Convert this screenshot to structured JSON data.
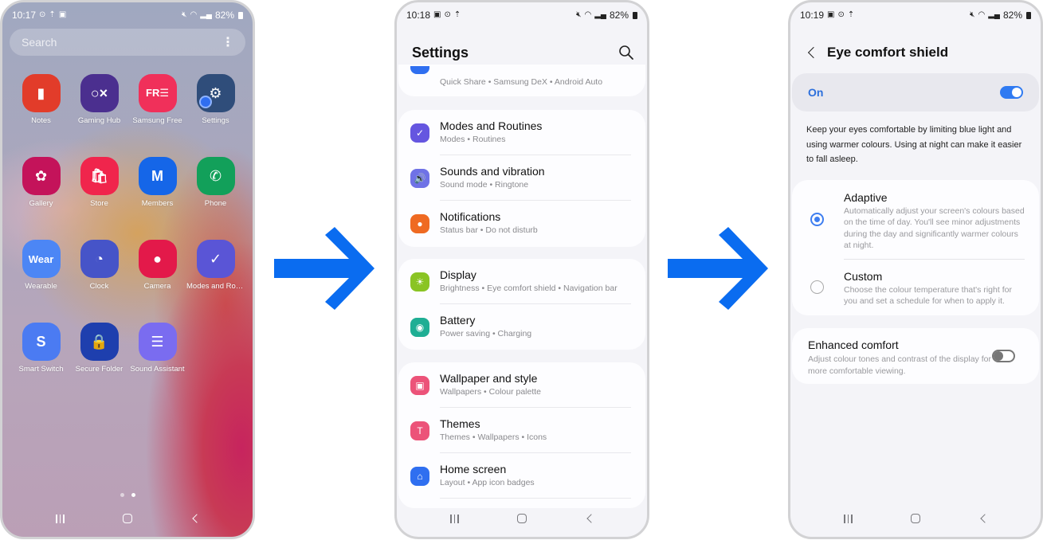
{
  "phone1": {
    "status": {
      "time": "10:17",
      "icons_left": [
        "sync-icon",
        "upload-icon",
        "image-icon"
      ],
      "icons_right": [
        "mute-icon",
        "wifi-icon",
        "signal-icon"
      ],
      "battery": "82%"
    },
    "search": {
      "placeholder": "Search",
      "menu_glyph": "⋮"
    },
    "apps": [
      {
        "label": "Notes",
        "icon": "notes-icon",
        "color": "#e23c2a",
        "glyph": "▮"
      },
      {
        "label": "Gaming Hub",
        "icon": "gaming-hub-icon",
        "color": "#4b2f8f",
        "glyph": "○×"
      },
      {
        "label": "Samsung Free",
        "icon": "samsung-free-icon",
        "color": "#f0305a",
        "glyph": "FR☰"
      },
      {
        "label": "Settings",
        "icon": "settings-gear-icon",
        "color": "#2f4d7a",
        "glyph": "⚙"
      },
      {
        "label": "Gallery",
        "icon": "gallery-flower-icon",
        "color": "#c4135a",
        "glyph": "✿"
      },
      {
        "label": "Store",
        "icon": "store-bag-icon",
        "color": "#f0254c",
        "glyph": "🛍"
      },
      {
        "label": "Members",
        "icon": "members-icon",
        "color": "#1566e8",
        "glyph": "M"
      },
      {
        "label": "Phone",
        "icon": "phone-icon",
        "color": "#12a05a",
        "glyph": "✆"
      },
      {
        "label": "Wearable",
        "icon": "wearable-icon",
        "color": "#4c86f5",
        "glyph": "Wear"
      },
      {
        "label": "Clock",
        "icon": "clock-icon",
        "color": "#4654c8",
        "glyph": "◔"
      },
      {
        "label": "Camera",
        "icon": "camera-icon",
        "color": "#e3194a",
        "glyph": "●"
      },
      {
        "label": "Modes and Rout...",
        "icon": "modes-routines-icon",
        "color": "#5a55d6",
        "glyph": "✓"
      },
      {
        "label": "Smart Switch",
        "icon": "smart-switch-icon",
        "color": "#4b7bf2",
        "glyph": "S"
      },
      {
        "label": "Secure Folder",
        "icon": "secure-folder-icon",
        "color": "#1e3fae",
        "glyph": "🔒"
      },
      {
        "label": "Sound Assistant",
        "icon": "sound-assistant-icon",
        "color": "#7a6cf0",
        "glyph": "☰"
      }
    ],
    "page_indicator": {
      "pages": 2,
      "active": 2
    }
  },
  "phone2": {
    "status": {
      "time": "10:18",
      "icons_left": [
        "image-icon",
        "sync-icon",
        "upload-icon"
      ],
      "battery": "82%"
    },
    "title": "Settings",
    "partial_row": {
      "subtitle": "Quick Share  •  Samsung DeX  •  Android Auto",
      "color": "#2f6ff0"
    },
    "groups": [
      [
        {
          "title": "Modes and Routines",
          "subtitle": "Modes  •  Routines",
          "icon": "modes-routines-icon",
          "color": "#6556e0",
          "glyph": "✓"
        },
        {
          "title": "Sounds and vibration",
          "subtitle": "Sound mode  •  Ringtone",
          "icon": "speaker-icon",
          "color": "#6f72e6",
          "glyph": "🔊"
        },
        {
          "title": "Notifications",
          "subtitle": "Status bar  •  Do not disturb",
          "icon": "notifications-icon",
          "color": "#ef6a22",
          "glyph": "●"
        }
      ],
      [
        {
          "title": "Display",
          "subtitle": "Brightness  •  Eye comfort shield  •  Navigation bar",
          "icon": "display-sun-icon",
          "color": "#8ac424",
          "glyph": "☀"
        },
        {
          "title": "Battery",
          "subtitle": "Power saving  •  Charging",
          "icon": "battery-icon",
          "color": "#1fae94",
          "glyph": "◉"
        }
      ],
      [
        {
          "title": "Wallpaper and style",
          "subtitle": "Wallpapers  •  Colour palette",
          "icon": "wallpaper-icon",
          "color": "#ec5379",
          "glyph": "▣"
        },
        {
          "title": "Themes",
          "subtitle": "Themes  •  Wallpapers  •  Icons",
          "icon": "themes-brush-icon",
          "color": "#ec5379",
          "glyph": "T"
        },
        {
          "title": "Home screen",
          "subtitle": "Layout  •  App icon badges",
          "icon": "home-icon",
          "color": "#2f6ff0",
          "glyph": "⌂"
        }
      ]
    ]
  },
  "phone3": {
    "status": {
      "time": "10:19",
      "icons_left": [
        "image-icon",
        "sync-icon",
        "upload-icon"
      ],
      "battery": "82%"
    },
    "title": "Eye comfort shield",
    "master": {
      "label": "On",
      "enabled": true
    },
    "description": "Keep your eyes comfortable by limiting blue light and using warmer colours. Using at night can make it easier to fall asleep.",
    "options": [
      {
        "title": "Adaptive",
        "description": "Automatically adjust your screen's colours based on the time of day. You'll see minor adjustments during the day and significantly warmer colours at night.",
        "selected": true
      },
      {
        "title": "Custom",
        "description": "Choose the colour temperature that's right for you and set a schedule for when to apply it.",
        "selected": false
      }
    ],
    "enhanced": {
      "title": "Enhanced comfort",
      "description": "Adjust colour tones and contrast of the display for more comfortable viewing.",
      "enabled": false
    }
  },
  "colors": {
    "arrow": "#0a6cf0",
    "accent": "#2f7af2"
  }
}
